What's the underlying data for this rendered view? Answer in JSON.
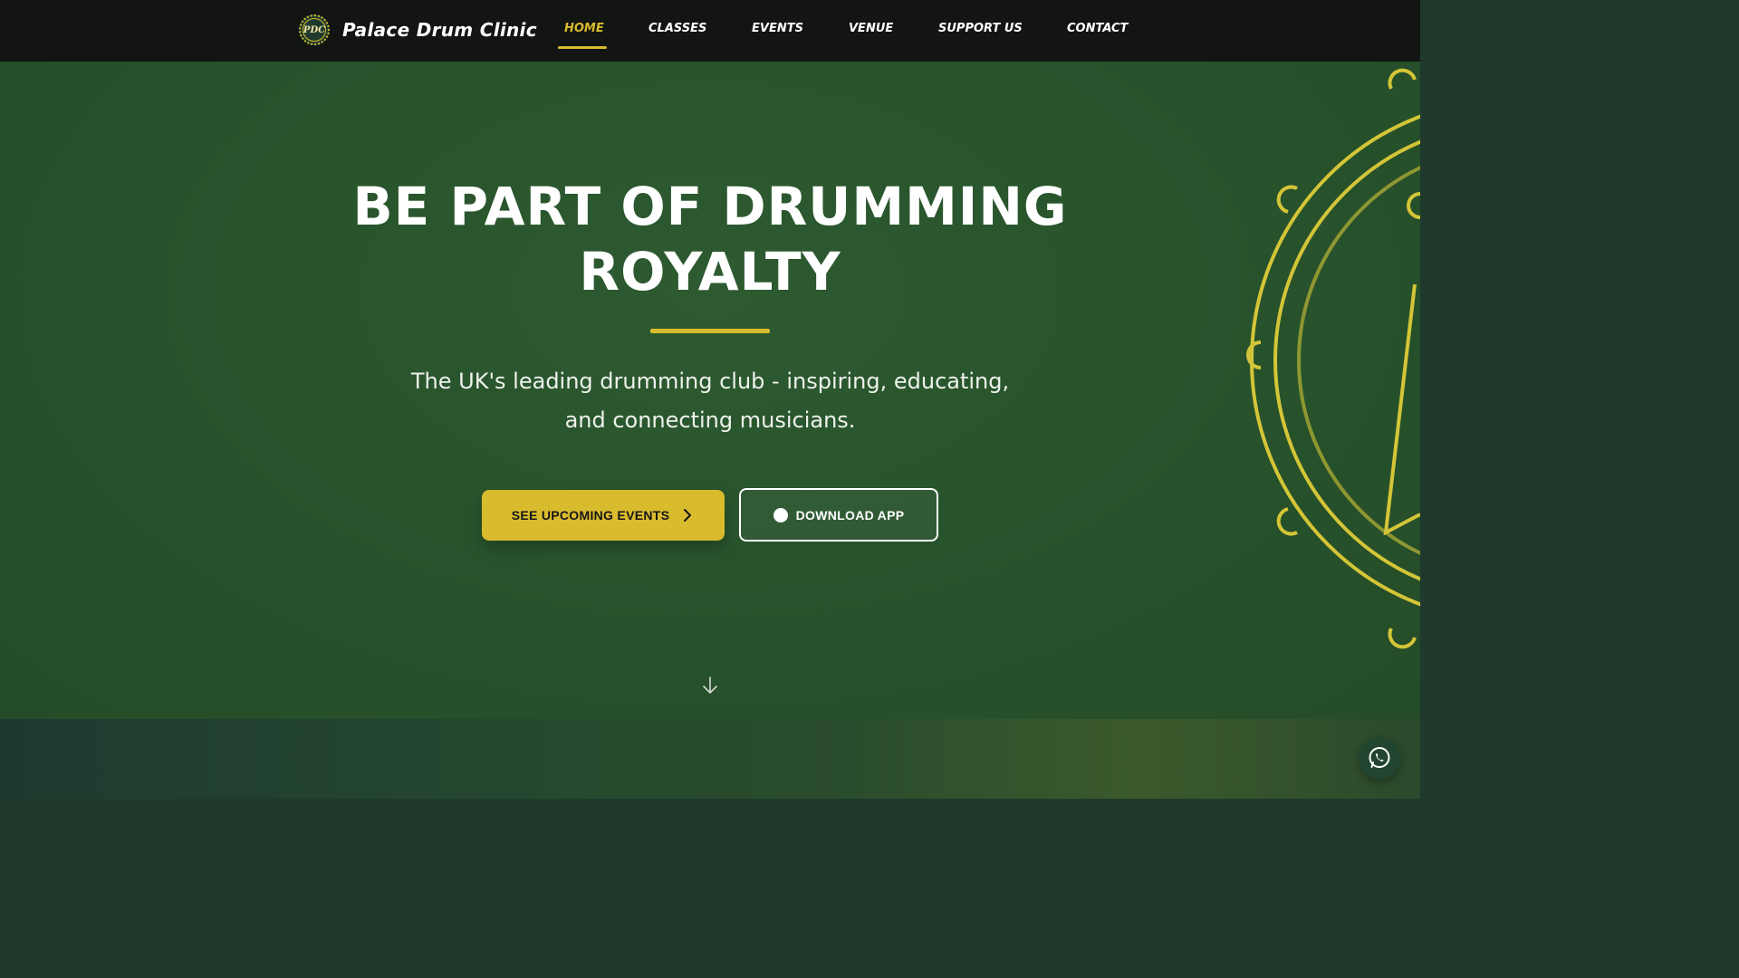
{
  "brand": {
    "logo_text": "PDC",
    "name": "Palace Drum Clinic"
  },
  "nav": {
    "items": [
      {
        "label": "HOME",
        "active": true
      },
      {
        "label": "CLASSES",
        "active": false
      },
      {
        "label": "EVENTS",
        "active": false
      },
      {
        "label": "VENUE",
        "active": false
      },
      {
        "label": "SUPPORT US",
        "active": false
      },
      {
        "label": "CONTACT",
        "active": false
      }
    ]
  },
  "hero": {
    "title_line1": "BE PART OF DRUMMING",
    "title_line2": "ROYALTY",
    "subtitle": "The UK's leading drumming club - inspiring, educating, and connecting musicians.",
    "primary_button": "SEE UPCOMING EVENTS",
    "secondary_button": "DOWNLOAD APP"
  },
  "icons": {
    "chevron": "chevron-right-icon",
    "app": "app-circle-icon",
    "scroll": "arrow-down-icon",
    "chat": "whatsapp-icon"
  },
  "colors": {
    "accent": "#d9bb2e",
    "nav_bg": "#121512",
    "hero_bg": "#28542c",
    "text_light": "#ffffff"
  }
}
